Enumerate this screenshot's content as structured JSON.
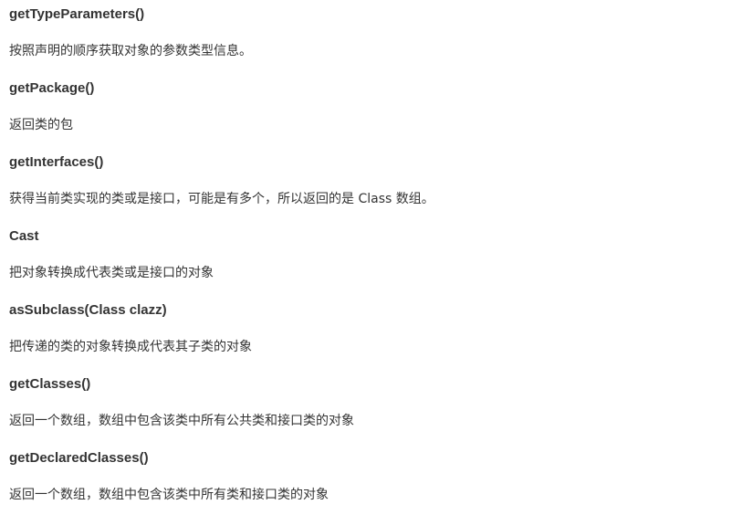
{
  "entries": [
    {
      "name": "getTypeParameters()",
      "description": "按照声明的顺序获取对象的参数类型信息。"
    },
    {
      "name": "getPackage()",
      "description": "返回类的包"
    },
    {
      "name": "getInterfaces()",
      "description": "获得当前类实现的类或是接口，可能是有多个，所以返回的是 Class 数组。"
    },
    {
      "name": "Cast",
      "description": "把对象转换成代表类或是接口的对象"
    },
    {
      "name": "asSubclass(Class clazz)",
      "description": "把传递的类的对象转换成代表其子类的对象"
    },
    {
      "name": "getClasses()",
      "description": "返回一个数组，数组中包含该类中所有公共类和接口类的对象"
    },
    {
      "name": "getDeclaredClasses()",
      "description": "返回一个数组，数组中包含该类中所有类和接口类的对象"
    }
  ]
}
